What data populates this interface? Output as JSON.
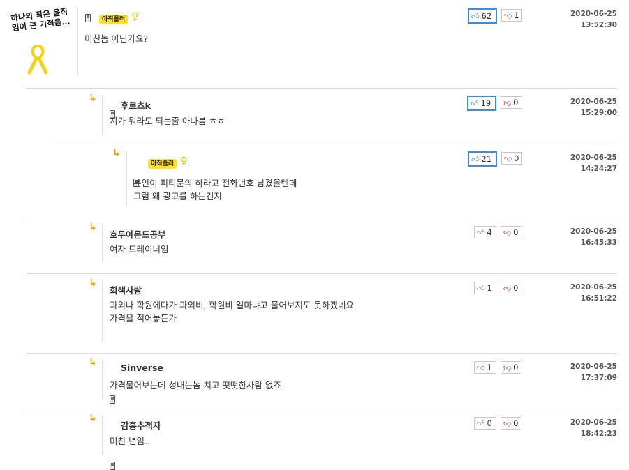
{
  "comments": [
    {
      "author": "",
      "badge": "아직플러",
      "text_lines": [
        "미친놈 아닌가요?"
      ],
      "likes": "62",
      "dislikes": "1",
      "date": "2020-06-25",
      "time": "13:52:30"
    },
    {
      "author": "후르츠k",
      "badge": "",
      "text_lines": [
        "지가 뭐라도 되는줄 아나봄 ㅎㅎ"
      ],
      "likes": "19",
      "dislikes": "0",
      "date": "2020-06-25",
      "time": "15:29:00"
    },
    {
      "author": "",
      "badge": "아직플러",
      "text_lines": [
        "본인이 피티문의 하라고 전화번호 남겼을텐데",
        "그럼 왜 광고를 하는건지"
      ],
      "likes": "21",
      "dislikes": "0",
      "date": "2020-06-25",
      "time": "14:24:27"
    },
    {
      "author": "호두아몬드공부",
      "badge": "",
      "text_lines": [
        "여자 트레이너임"
      ],
      "likes": "4",
      "dislikes": "0",
      "date": "2020-06-25",
      "time": "16:45:33"
    },
    {
      "author": "회색사람",
      "badge": "",
      "text_lines": [
        "과외나 학원에다가 과외비, 학원비 얼마냐고 물어보지도 못하겠네요",
        "가격을 적어놓든가"
      ],
      "likes": "1",
      "dislikes": "0",
      "date": "2020-06-25",
      "time": "16:51:22"
    },
    {
      "author": "Sinverse",
      "badge": "",
      "text_lines": [
        "가격물어보는데 성내는놈 치고 떳떳한사람 없죠"
      ],
      "likes": "1",
      "dislikes": "0",
      "date": "2020-06-25",
      "time": "17:37:09"
    },
    {
      "author": "감흥추적자",
      "badge": "",
      "text_lines": [
        "미친 년임.."
      ],
      "likes": "0",
      "dislikes": "0",
      "date": "2020-06-25",
      "time": "18:42:23"
    }
  ],
  "avatar_caption": "하나의 작은 움직임이 큰 기적을...",
  "icons": {
    "reply": "reply-arrow-icon",
    "mobile": "mobile-phone-icon",
    "ribbon": "yellow-ribbon-icon",
    "like": "thumbs-up-icon",
    "dislike": "thumbs-down-icon"
  },
  "colors": {
    "active_vote_border": "#3a8fd6",
    "reply_arrow": "#e8a400",
    "badge_bg": "#ffe033"
  }
}
